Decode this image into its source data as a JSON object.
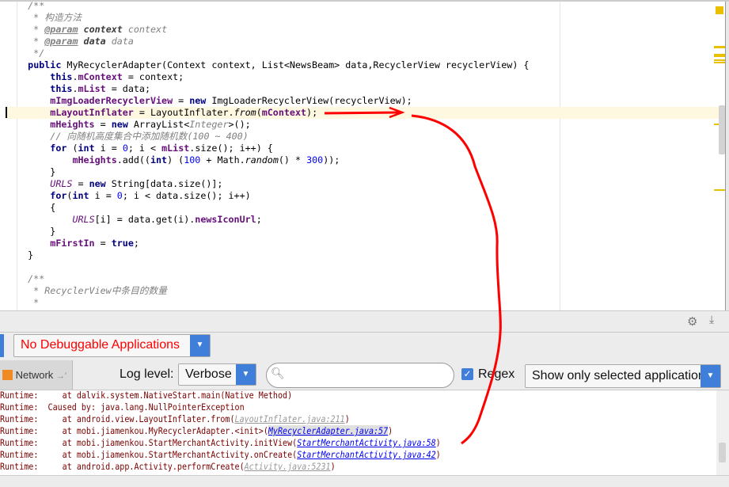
{
  "editor": {
    "lines": [
      [
        [
          "    /**",
          "dc"
        ]
      ],
      [
        [
          "     * 构造方法",
          "dc"
        ]
      ],
      [
        [
          "     * ",
          "dc"
        ],
        [
          "@param",
          "dt"
        ],
        [
          " ",
          "dc"
        ],
        [
          "context",
          "dp"
        ],
        [
          " context",
          "dc"
        ]
      ],
      [
        [
          "     * ",
          "dc"
        ],
        [
          "@param",
          "dt"
        ],
        [
          " ",
          "dc"
        ],
        [
          "data",
          "dp"
        ],
        [
          " data",
          "dc"
        ]
      ],
      [
        [
          "     */",
          "dc"
        ]
      ],
      [
        [
          "    ",
          ""
        ],
        [
          "public",
          "kw"
        ],
        [
          " MyRecyclerAdapter(Context context, List<NewsBeam> data,RecyclerView recyclerView) {",
          ""
        ]
      ],
      [
        [
          "        ",
          ""
        ],
        [
          "this",
          "kw"
        ],
        [
          ".",
          ""
        ],
        [
          "mContext",
          "fd"
        ],
        [
          " = context;",
          ""
        ]
      ],
      [
        [
          "        ",
          ""
        ],
        [
          "this",
          "kw"
        ],
        [
          ".",
          ""
        ],
        [
          "mList",
          "fd"
        ],
        [
          " = data;",
          ""
        ]
      ],
      [
        [
          "        ",
          ""
        ],
        [
          "mImgLoaderRecyclerView",
          "fd"
        ],
        [
          " = ",
          ""
        ],
        [
          "new",
          "kw"
        ],
        [
          " ImgLoaderRecyclerView(recyclerView);",
          ""
        ]
      ],
      [
        [
          "        ",
          ""
        ],
        [
          "mLayoutInflater",
          "fd"
        ],
        [
          " = LayoutInflater.",
          ""
        ],
        [
          "from",
          "it"
        ],
        [
          "(",
          ""
        ],
        [
          "mContext",
          "fd"
        ],
        [
          ");",
          ""
        ]
      ],
      [
        [
          "        ",
          ""
        ],
        [
          "mHeights",
          "fd"
        ],
        [
          " = ",
          ""
        ],
        [
          "new",
          "kw"
        ],
        [
          " ArrayList<",
          ""
        ],
        [
          "Integer",
          "dc"
        ],
        [
          ">();",
          ""
        ]
      ],
      [
        [
          "        // 向随机高度集合中添加随机数(100 ~ 400)",
          "cm"
        ]
      ],
      [
        [
          "        ",
          ""
        ],
        [
          "for",
          "kw"
        ],
        [
          " (",
          ""
        ],
        [
          "int",
          "kw"
        ],
        [
          " i = ",
          ""
        ],
        [
          "0",
          "nm"
        ],
        [
          "; i < ",
          ""
        ],
        [
          "mList",
          "fd"
        ],
        [
          ".size(); i++) {",
          ""
        ]
      ],
      [
        [
          "            ",
          ""
        ],
        [
          "mHeights",
          "fd"
        ],
        [
          ".add((",
          ""
        ],
        [
          "int",
          "kw"
        ],
        [
          ") (",
          ""
        ],
        [
          "100",
          "nm"
        ],
        [
          " + Math.",
          ""
        ],
        [
          "random",
          "it"
        ],
        [
          "() * ",
          ""
        ],
        [
          "300",
          "nm"
        ],
        [
          "));",
          ""
        ]
      ],
      [
        [
          "        }",
          ""
        ]
      ],
      [
        [
          "        ",
          ""
        ],
        [
          "URLS",
          "st"
        ],
        [
          " = ",
          ""
        ],
        [
          "new",
          "kw"
        ],
        [
          " String[data.size()];",
          ""
        ]
      ],
      [
        [
          "        ",
          ""
        ],
        [
          "for",
          "kw"
        ],
        [
          "(",
          ""
        ],
        [
          "int",
          "kw"
        ],
        [
          " i = ",
          ""
        ],
        [
          "0",
          "nm"
        ],
        [
          "; i < data.size(); i++)",
          ""
        ]
      ],
      [
        [
          "        {",
          ""
        ]
      ],
      [
        [
          "            ",
          ""
        ],
        [
          "URLS",
          "st"
        ],
        [
          "[i] = data.get(i).",
          ""
        ],
        [
          "newsIconUrl",
          "fd"
        ],
        [
          ";",
          ""
        ]
      ],
      [
        [
          "        }",
          ""
        ]
      ],
      [
        [
          "        ",
          ""
        ],
        [
          "mFirstIn",
          "fd"
        ],
        [
          " = ",
          ""
        ],
        [
          "true",
          "kw"
        ],
        [
          ";",
          ""
        ]
      ],
      [
        [
          "    }",
          ""
        ]
      ],
      [
        [
          "",
          ""
        ]
      ],
      [
        [
          "    /**",
          "dc"
        ]
      ],
      [
        [
          "     * RecyclerView中条目的数量",
          "dc"
        ]
      ],
      [
        [
          "     *",
          "dc"
        ]
      ]
    ],
    "highlight_line": 9
  },
  "toolbar": {
    "settings_icon": "gear-icon",
    "download_icon": "download-icon"
  },
  "device_select": {
    "value": "No Debuggable Applications",
    "color": "#ff0000"
  },
  "filter": {
    "network_tab": "Network",
    "log_level_label": "Log level:",
    "log_level_value": "Verbose",
    "search_placeholder": "",
    "regex_label": "Regex",
    "regex_checked": true,
    "app_filter_value": "Show only selected application"
  },
  "log": {
    "lines": [
      [
        [
          "Runtime:     at dalvik.system.NativeStart.main(Native Method)",
          ""
        ]
      ],
      [
        [
          "Runtime:  Caused by: java.lang.NullPointerException",
          ""
        ]
      ],
      [
        [
          "Runtime:     at android.view.LayoutInflater.from(",
          ""
        ],
        [
          "LayoutInflater.java:211",
          "gl"
        ],
        [
          ")",
          ""
        ]
      ],
      [
        [
          "Runtime:     at mobi.jiamenkou.MyRecyclerAdapter.<init>(",
          ""
        ],
        [
          "MyRecyclerAdapter.java:57",
          "lnk sel"
        ],
        [
          ")",
          ""
        ]
      ],
      [
        [
          "Runtime:     at mobi.jiamenkou.StartMerchantActivity.initView(",
          ""
        ],
        [
          "StartMerchantActivity.java:58",
          "lnk"
        ],
        [
          ")",
          ""
        ]
      ],
      [
        [
          "Runtime:     at mobi.jiamenkou.StartMerchantActivity.onCreate(",
          ""
        ],
        [
          "StartMerchantActivity.java:42",
          "lnk"
        ],
        [
          ")",
          ""
        ]
      ],
      [
        [
          "Runtime:     at android.app.Activity.performCreate(",
          ""
        ],
        [
          "Activity.java:5231",
          "gl"
        ],
        [
          ")",
          ""
        ]
      ]
    ]
  },
  "annotation_color": "#ff0000"
}
